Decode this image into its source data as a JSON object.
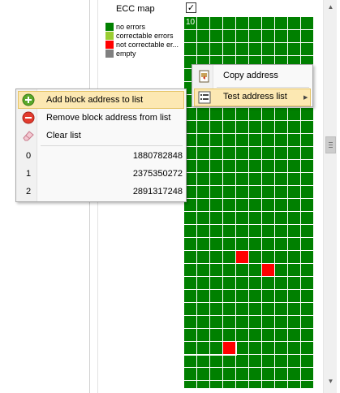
{
  "ecc_panel": {
    "title": "ECC map",
    "checked": true,
    "check_glyph": "✓",
    "grid_start_label": "10",
    "legend": [
      {
        "label": "no errors",
        "color": "#008000"
      },
      {
        "label": "correctable errors",
        "color": "#9acd32"
      },
      {
        "label": "not correctable er...",
        "color": "#ff0000"
      },
      {
        "label": "empty",
        "color": "#808080"
      }
    ],
    "colors": {
      "no_errors": "#008000",
      "correctable": "#9acd32",
      "not_correctable": "#ff0000",
      "empty": "#808080"
    }
  },
  "address_menu": {
    "items": [
      {
        "label": "Copy address",
        "icon": "copy-address-icon"
      },
      {
        "label": "Test address list",
        "icon": "list-icon",
        "has_submenu": true,
        "highlighted": true
      }
    ]
  },
  "list_menu": {
    "items": [
      {
        "label": "Add block address to list",
        "icon": "add-icon",
        "highlighted": true
      },
      {
        "label": "Remove block address from list",
        "icon": "remove-icon"
      },
      {
        "label": "Clear list",
        "icon": "eraser-icon"
      }
    ],
    "addresses": [
      {
        "index": "0",
        "value": "1880782848"
      },
      {
        "index": "1",
        "value": "2375350272"
      },
      {
        "index": "2",
        "value": "2891317248"
      }
    ]
  },
  "scrollbar": {
    "up_glyph": "▲",
    "down_glyph": "▼"
  }
}
